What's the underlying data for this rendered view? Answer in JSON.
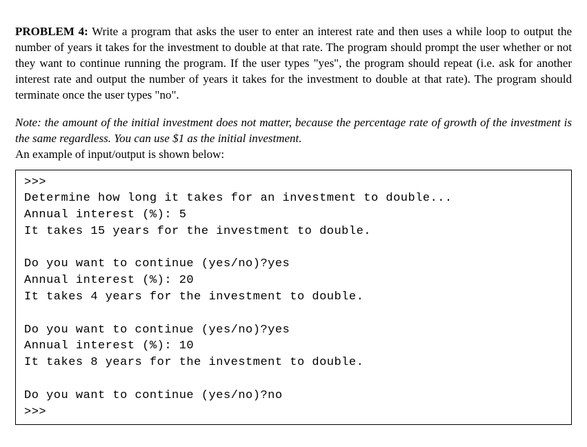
{
  "problem": {
    "label": "PROBLEM 4:",
    "text": "Write a program that asks the user to enter an interest rate and then uses a while loop to output the number of years it takes for the investment to double at that rate. The program should prompt the user whether or not they want to continue running the program. If the user types \"yes\", the program should repeat (i.e. ask for another interest rate and output the number of years it takes for the investment to double at that rate). The program should terminate once the user types \"no\"."
  },
  "note": "Note: the amount of the initial investment does not matter, because the percentage rate of growth of the investment is the same regardless. You can use $1 as the initial investment.",
  "example_intro": "An example of input/output is shown below:",
  "code_lines": [
    ">>>",
    "Determine how long it takes for an investment to double...",
    "Annual interest (%): 5",
    "It takes 15 years for the investment to double.",
    "",
    "Do you want to continue (yes/no)?yes",
    "Annual interest (%): 20",
    "It takes 4 years for the investment to double.",
    "",
    "Do you want to continue (yes/no)?yes",
    "Annual interest (%): 10",
    "It takes 8 years for the investment to double.",
    "",
    "Do you want to continue (yes/no)?no",
    ">>>"
  ]
}
